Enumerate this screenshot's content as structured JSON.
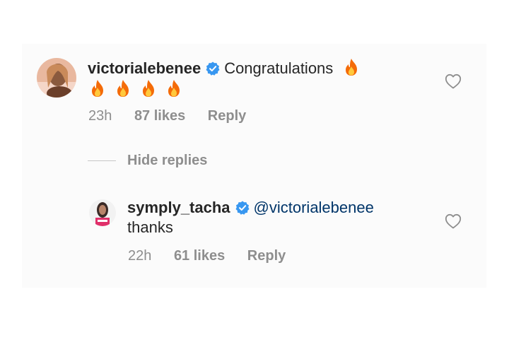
{
  "comment": {
    "username": "victorialebenee",
    "text": "Congratulations",
    "age": "23h",
    "likes": "87 likes",
    "reply": "Reply"
  },
  "replies_toggle": "Hide replies",
  "reply_comment": {
    "username": "symply_tacha",
    "mention": "@victorialebenee",
    "text": "thanks",
    "age": "22h",
    "likes": "61 likes",
    "reply": "Reply"
  },
  "icons": {
    "verified": "verified-badge-icon",
    "like": "heart-outline-icon",
    "emoji": "fire-emoji"
  },
  "colors": {
    "verified": "#3897f0",
    "fire_outer": "#f46b08",
    "fire_inner": "#ffc93c",
    "muted": "#8e8e8e"
  }
}
